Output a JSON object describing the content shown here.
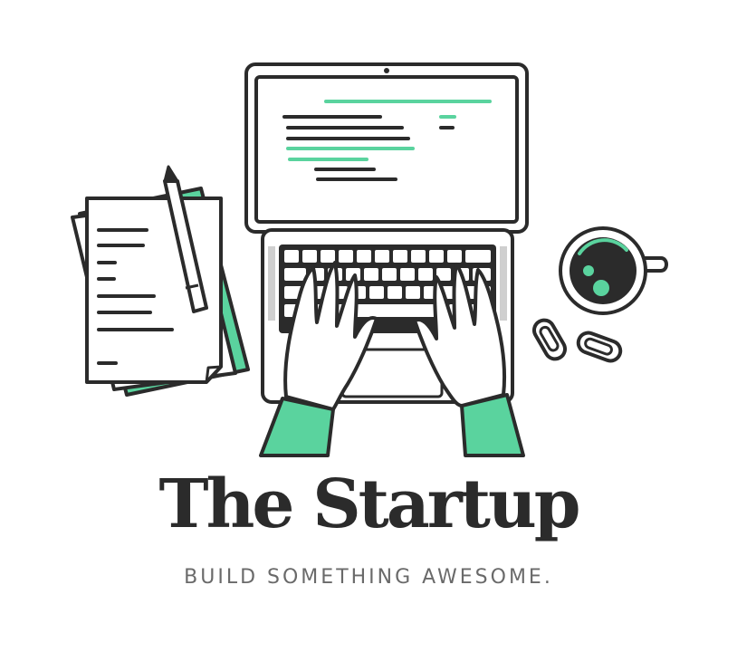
{
  "brand": {
    "title": "The Startup",
    "tagline": "BUILD SOMETHING AWESOME."
  },
  "colors": {
    "ink": "#2b2b2b",
    "accent": "#5ad39e",
    "tagline": "#6a6a6a",
    "background": "#ffffff"
  },
  "icons": {
    "documents": "document-stack-icon",
    "pencil": "pencil-icon",
    "laptop": "laptop-icon",
    "hands": "typing-hands-icon",
    "coffee": "coffee-cup-icon",
    "clips": "paper-clip-icon"
  }
}
